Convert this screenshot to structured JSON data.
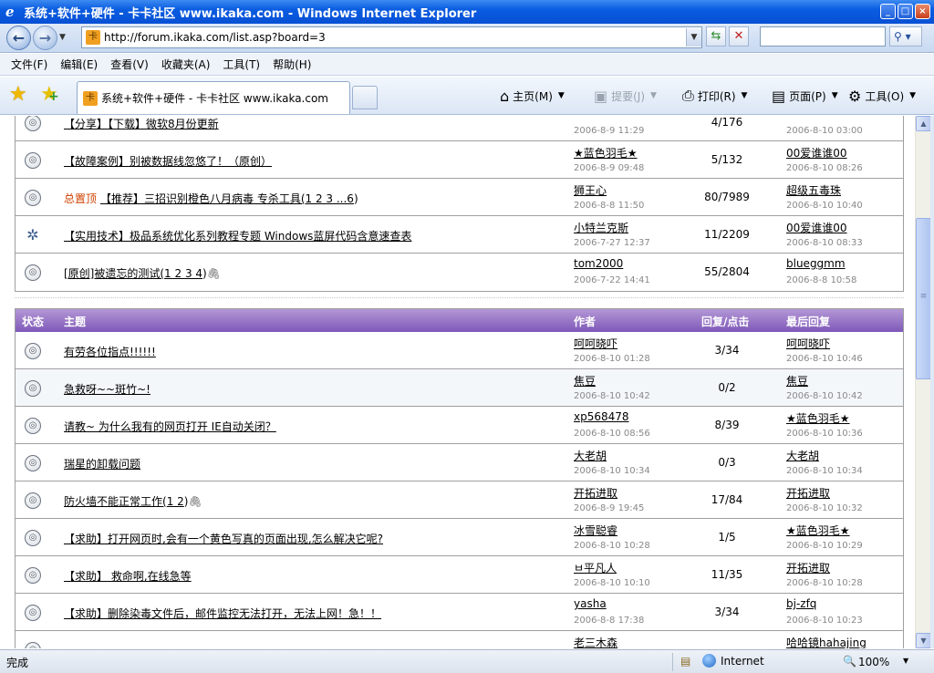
{
  "window": {
    "title": "系统+软件+硬件 - 卡卡社区 www.ikaka.com - Windows Internet Explorer",
    "icon": "ie-icon",
    "buttons": {
      "minimize": "_",
      "maximize": "□",
      "close": "×"
    }
  },
  "address": {
    "url": "http://forum.ikaka.com/list.asp?board=3",
    "search_placeholder": ""
  },
  "menu": [
    "文件(F)",
    "编辑(E)",
    "查看(V)",
    "收藏夹(A)",
    "工具(T)",
    "帮助(H)"
  ],
  "tab": {
    "label": "系统+软件+硬件 - 卡卡社区 www.ikaka.com"
  },
  "commands": {
    "home": "主页(M)",
    "feeds": "提要(J)",
    "print": "打印(R)",
    "page": "页面(P)",
    "tools": "工具(O)"
  },
  "sticky_threads": [
    {
      "topic": "【分享】【下载】微软8月份更新",
      "author": "",
      "author_date": "2006-8-9 11:29",
      "counts": "4/176",
      "last_user": "",
      "last_date": "2006-8-10 03:00",
      "icon": "normal"
    },
    {
      "topic": "【故障案例】别被数据线忽悠了！（原创）",
      "author": "★蓝色羽毛★",
      "author_date": "2006-8-9 09:48",
      "counts": "5/132",
      "last_user": "00爱谁谁00",
      "last_date": "2006-8-10 08:26",
      "icon": "normal"
    },
    {
      "prefix": "总置顶",
      "topic": "【推荐】三招识别橙色八月病毒 专杀工具(",
      "pages": "1 2 3 ...6",
      "suffix": ")",
      "author": "狮王心",
      "author_date": "2006-8-8 11:50",
      "counts": "80/7989",
      "last_user": "超级五毒珠",
      "last_date": "2006-8-10 10:40",
      "icon": "normal"
    },
    {
      "topic": "【实用技术】极品系统优化系列教程专题 Windows蓝屏代码含意速查表",
      "author": "小特兰克斯",
      "author_date": "2006-7-27 12:37",
      "counts": "11/2209",
      "last_user": "00爱谁谁00",
      "last_date": "2006-8-10 08:33",
      "icon": "special"
    },
    {
      "topic": "[原创]被遗忘的测试(",
      "pages": "1 2 3 4",
      "suffix": ")",
      "clip": true,
      "author": "tom2000",
      "author_date": "2006-7-22 14:41",
      "counts": "55/2804",
      "last_user": "blueggmm",
      "last_date": "2006-8-8 10:58",
      "icon": "normal"
    }
  ],
  "table_header": {
    "status": "状态",
    "topic": "主题",
    "author": "作者",
    "counts": "回复/点击",
    "last": "最后回复"
  },
  "threads": [
    {
      "topic": "有劳各位指点!!!!!!",
      "author": "呵呵晓吓",
      "author_date": "2006-8-10 01:28",
      "counts": "3/34",
      "last_user": "呵呵晓吓",
      "last_date": "2006-8-10 10:46"
    },
    {
      "topic": "急救呀~~斑竹~!",
      "author": "焦豆",
      "author_date": "2006-8-10 10:42",
      "counts": "0/2",
      "last_user": "焦豆",
      "last_date": "2006-8-10 10:42"
    },
    {
      "topic": "请教~ 为什么我有的网页打开 IE自动关闭？",
      "author": "xp568478",
      "author_date": "2006-8-10 08:56",
      "counts": "8/39",
      "last_user": "★蓝色羽毛★",
      "last_date": "2006-8-10 10:36"
    },
    {
      "topic": "瑞星的卸载问题",
      "author": "大老胡",
      "author_date": "2006-8-10 10:34",
      "counts": "0/3",
      "last_user": "大老胡",
      "last_date": "2006-8-10 10:34"
    },
    {
      "topic": "防火墙不能正常工作(",
      "pages": "1 2",
      "suffix": ")",
      "clip": true,
      "author": "开拓进取",
      "author_date": "2006-8-9 19:45",
      "counts": "17/84",
      "last_user": "开拓进取",
      "last_date": "2006-8-10 10:32"
    },
    {
      "topic": "【求助】打开网页时,会有一个黄色写真的页面出现,怎么解决它呢?",
      "author": "冰雪聪睿",
      "author_date": "2006-8-10 10:28",
      "counts": "1/5",
      "last_user": "★蓝色羽毛★",
      "last_date": "2006-8-10 10:29"
    },
    {
      "topic": "【求助】 救命啊,在线急等",
      "author": "ㅂ平凡人",
      "author_date": "2006-8-10 10:10",
      "counts": "11/35",
      "last_user": "开拓进取",
      "last_date": "2006-8-10 10:28"
    },
    {
      "topic": "【求助】删除染毒文件后，邮件监控无法打开，无法上网！急！！",
      "author": "yasha",
      "author_date": "2006-8-8 17:38",
      "counts": "3/34",
      "last_user": "bj-zfq",
      "last_date": "2006-8-10 10:23"
    },
    {
      "topic": "",
      "author": "老三木森",
      "author_date": "",
      "counts": "",
      "last_user": "哈哈镜hahajing",
      "last_date": ""
    }
  ],
  "statusbar": {
    "text": "完成",
    "zone": "Internet",
    "zoom": "100%"
  }
}
